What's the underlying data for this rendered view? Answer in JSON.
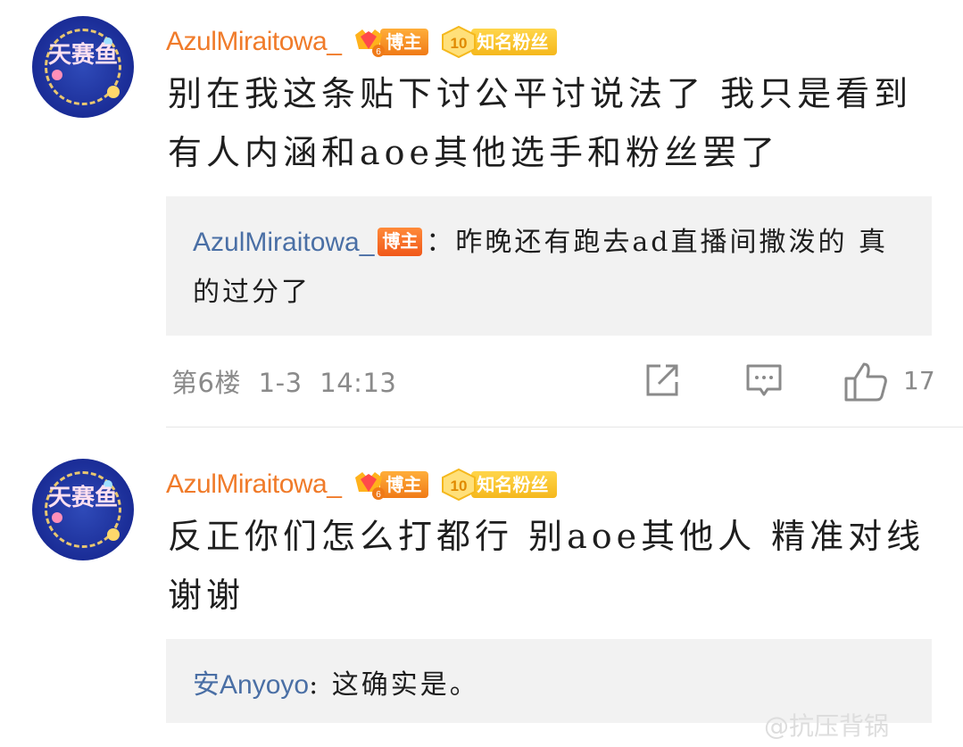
{
  "comments": [
    {
      "username": "AzulMiraitowa_",
      "host_badge": "博主",
      "fan_badge_level": "10",
      "fan_badge": "知名粉丝",
      "avatar_text": "天赛鱼",
      "content": "别在我这条贴下讨公平讨说法了 我只是看到有人内涵和aoe其他选手和粉丝罢了",
      "reply": {
        "user": "AzulMiraitowa_",
        "user_badge": "博主",
        "text": "：昨晚还有跑去ad直播间撒泼的 真的过分了"
      },
      "floor": "第6楼",
      "date": "1-3",
      "time": "14:13",
      "like_count": "17"
    },
    {
      "username": "AzulMiraitowa_",
      "host_badge": "博主",
      "fan_badge_level": "10",
      "fan_badge": "知名粉丝",
      "avatar_text": "天赛鱼",
      "content": "反正你们怎么打都行 别aoe其他人 精准对线 谢谢",
      "reply": {
        "user": "安Anyoyo",
        "text": ": 这确实是。"
      }
    }
  ],
  "watermark": "@抗压背锅"
}
